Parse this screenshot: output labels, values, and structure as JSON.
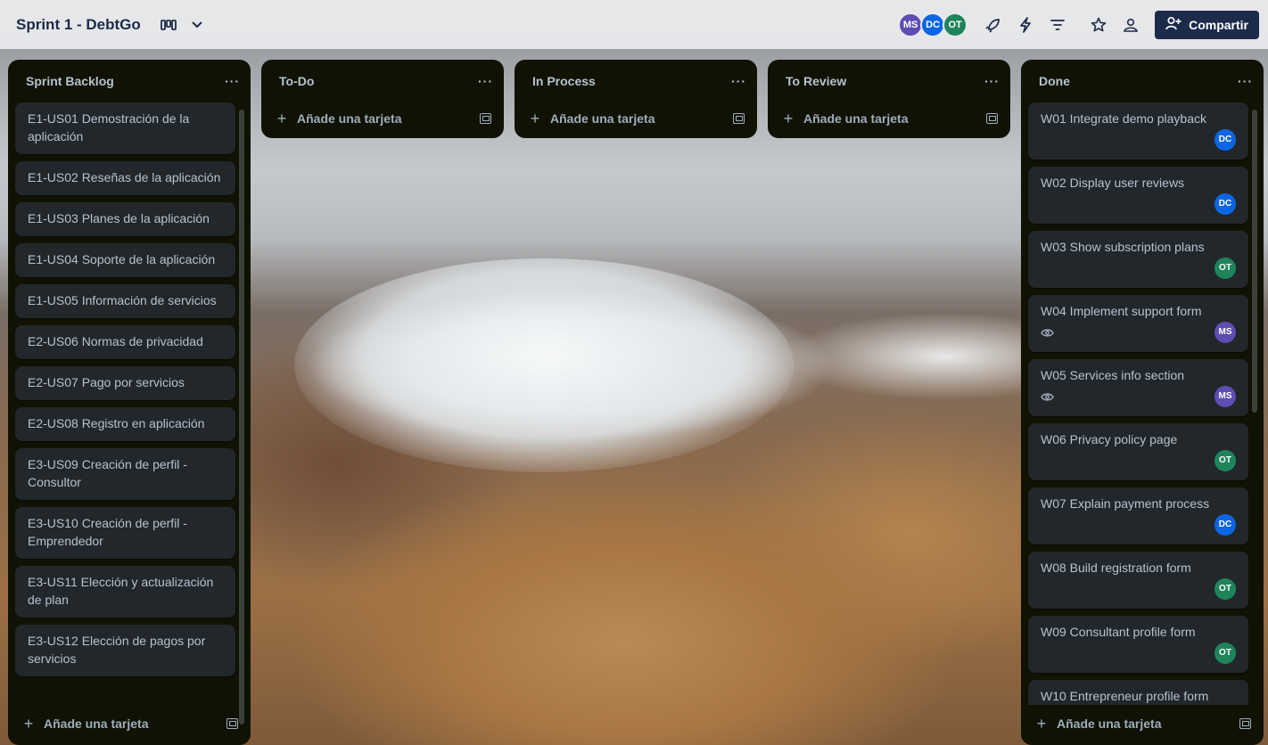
{
  "board": {
    "title": "Sprint 1 - DebtGo",
    "share_label": "Compartir"
  },
  "members": [
    {
      "initials": "MS",
      "color": "#5e4db2"
    },
    {
      "initials": "DC",
      "color": "#0c66e4"
    },
    {
      "initials": "OT",
      "color": "#1f845a"
    }
  ],
  "icons": {
    "view": "board-view-icon",
    "chevron": "chevron-down-icon",
    "powerups": "rocket-icon",
    "automation": "lightning-icon",
    "filter": "filter-icon",
    "star": "star-icon",
    "visibility": "team-visibility-icon",
    "share": "add-person-icon"
  },
  "add_card_label": "Añade una tarjeta",
  "menu_label": "···",
  "lists": {
    "backlog": {
      "title": "Sprint Backlog",
      "cards": [
        "E1-US01 Demostración de la aplicación",
        "E1-US02 Reseñas de la aplicación",
        "E1-US03 Planes de la aplicación",
        "E1-US04 Soporte de la aplicación",
        "E1-US05 Información de servicios",
        "E2-US06 Normas de privacidad",
        "E2-US07 Pago por servicios",
        "E2-US08 Registro en aplicación",
        "E3-US09 Creación de perfil - Consultor",
        "E3-US10 Creación de perfil - Emprendedor",
        "E3-US11 Elección y actualización de plan",
        "E3-US12 Elección de pagos por servicios"
      ]
    },
    "todo": {
      "title": "To-Do"
    },
    "inprocess": {
      "title": "In Process"
    },
    "toreview": {
      "title": "To Review"
    },
    "done": {
      "title": "Done",
      "cards": [
        {
          "title": "W01 Integrate demo playback",
          "member": "DC",
          "watch": false
        },
        {
          "title": "W02 Display user reviews",
          "member": "DC",
          "watch": false
        },
        {
          "title": "W03 Show subscription plans",
          "member": "OT",
          "watch": false
        },
        {
          "title": "W04 Implement support form",
          "member": "MS",
          "watch": true
        },
        {
          "title": "W05 Services info section",
          "member": "MS",
          "watch": true
        },
        {
          "title": "W06 Privacy policy page",
          "member": "OT",
          "watch": false
        },
        {
          "title": "W07 Explain payment process",
          "member": "DC",
          "watch": false
        },
        {
          "title": "W08 Build registration form",
          "member": "OT",
          "watch": false
        },
        {
          "title": "W09 Consultant profile form",
          "member": "OT",
          "watch": false
        },
        {
          "title": "W10 Entrepreneur profile form",
          "member": "",
          "watch": false
        }
      ]
    }
  }
}
